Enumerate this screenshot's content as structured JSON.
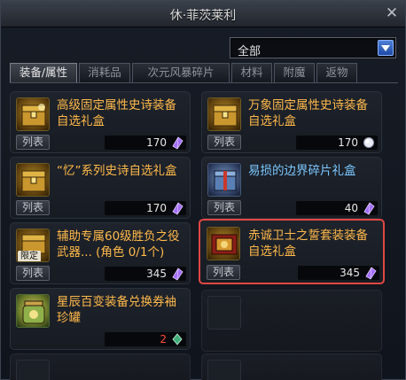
{
  "window": {
    "title": "休·菲茨莱利",
    "close_label": "✕"
  },
  "filter": {
    "selected": "全部"
  },
  "tabs": [
    {
      "label": "装备/属性",
      "active": true
    },
    {
      "label": "消耗品",
      "active": false
    },
    {
      "label": "次元风暴碎片",
      "active": false
    },
    {
      "label": "材料",
      "active": false
    },
    {
      "label": "附魔",
      "active": false
    },
    {
      "label": "返物",
      "active": false
    }
  ],
  "list_label": "列表",
  "items": [
    {
      "name": "高级固定属性史诗装备自选礼盒",
      "price": "170",
      "currency_icon": "purple-crystal-icon",
      "icon": "gold-chest-icon"
    },
    {
      "name": "万象固定属性史诗装备自选礼盒",
      "price": "170",
      "currency_icon": "white-orb-icon",
      "icon": "gold-chest-icon"
    },
    {
      "name": "“忆”系列史诗自选礼盒",
      "price": "170",
      "currency_icon": "purple-crystal-icon",
      "icon": "gold-chest-icon"
    },
    {
      "name": "易损的边界碎片礼盒",
      "price": "40",
      "currency_icon": "purple-crystal-icon",
      "icon": "blue-box-icon"
    },
    {
      "name": "辅助专属60级胜负之役武器... (角色 0/1个)",
      "price": "345",
      "currency_icon": "purple-crystal-icon",
      "icon": "gold-chest-icon",
      "badge": "限定"
    },
    {
      "name": "赤诚卫士之誓套装装备自选礼盒",
      "price": "345",
      "currency_icon": "purple-crystal-icon",
      "icon": "gold-chest-icon"
    },
    {
      "name": "星辰百变装备兑换券袖珍罐",
      "price": "2",
      "currency_icon": "green-gem-icon",
      "icon": "jar-icon"
    }
  ],
  "colors": {
    "item_name": "#ffb94a",
    "item_name_blue": "#7cc8ff",
    "selected_border": "#e24744",
    "insufficient_price": "#ff4b3a"
  }
}
